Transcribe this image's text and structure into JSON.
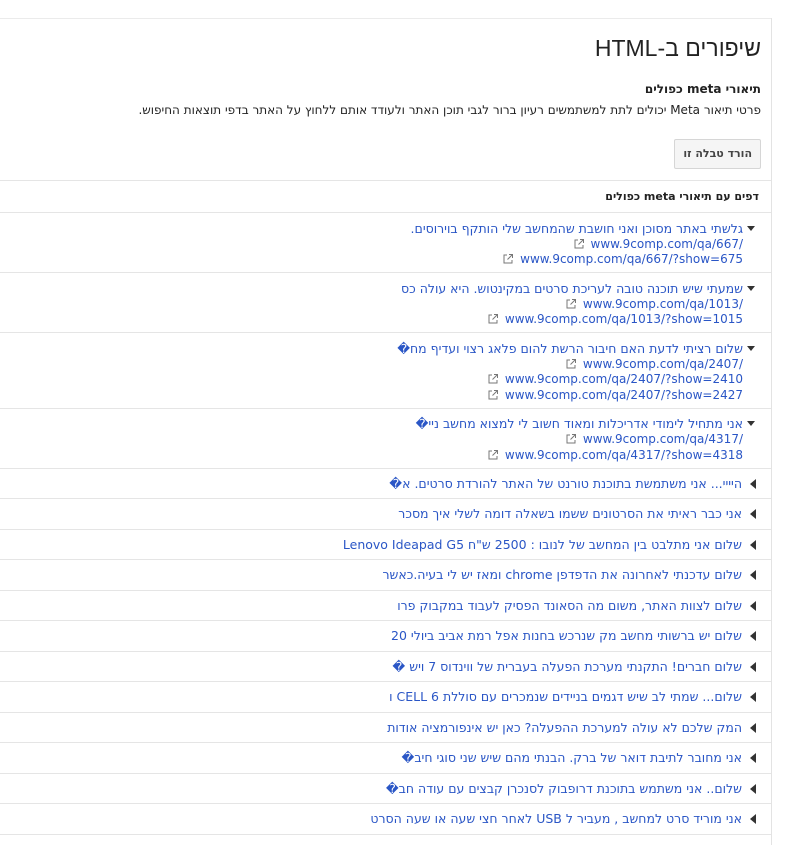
{
  "page_title": "שיפורים ב-HTML",
  "section": {
    "title": "תיאורי meta כפולים",
    "description": "פרטי תיאור Meta יכולים לתת למשתמשים רעיון ברור לגבי תוכן האתר ולעודד אותם ללחוץ על האתר בדפי תוצאות החיפוש."
  },
  "download_button": "הורד טבלה זו",
  "table_header": "דפים עם תיאורי meta כפולים",
  "expanded_rows": [
    {
      "title": "גלשתי באתר מסוכן ואני חושבת שהמחשב שלי הותקף בוירוסים.",
      "urls": [
        "www.9comp.com/qa/667/",
        "www.9comp.com/qa/667/?show=675"
      ]
    },
    {
      "title": "שמעתי שיש תוכנה טובה לעריכת סרטים במקינטוש. היא עולה כס",
      "urls": [
        "www.9comp.com/qa/1013/",
        "www.9comp.com/qa/1013/?show=1015"
      ]
    },
    {
      "title": "שלום רציתי לדעת האם חיבור הרשת להום פלאג רצוי ועדיף מח�",
      "urls": [
        "www.9comp.com/qa/2407/",
        "www.9comp.com/qa/2407/?show=2410",
        "www.9comp.com/qa/2407/?show=2427"
      ]
    },
    {
      "title": "אני מתחיל לימודי אדריכלות ומאוד חשוב לי למצוא מחשב ניי�",
      "urls": [
        "www.9comp.com/qa/4317/",
        "www.9comp.com/qa/4317/?show=4318"
      ]
    }
  ],
  "collapsed_rows": [
    "היייי... אני משתמשת בתוכנת טורנט של האתר להורדת סרטים. א�",
    "אני כבר ראיתי את הסרטונים ששמו בשאלה דומה לשלי איך מסכר",
    "שלום אני מתלבט בין המחשב של לנובו : 2500 ש\"ח Lenovo Ideapad G5",
    "שלום עדכנתי לאחרונה את הדפדפן chrome ומאז יש לי בעיה.כאשר",
    "שלום לצוות האתר, משום מה הסאונד הפסיק לעבוד במקבוק פרו",
    "שלום יש ברשותי מחשב מק שנרכש בחנות אפל רמת אביב ביולי 20",
    "שלום חברים! התקנתי מערכת הפעלה בעברית של ווינדוס 7 ויש �",
    "שלום... שמתי לב שיש דגמים בניידים שנמכרים עם סוללת 6 CELL ו",
    "המק שלכם לא עולה למערכת ההפעלה? כאן יש אינפורמציה אודות",
    "אני מחובר לתיבת דואר של ברק. הבנתי מהם שיש שני סוגי חיב�",
    "שלום.. אני משתמש בתוכנת דרופבוק לסנכרן קבצים עם עודה חב�",
    "אני מוריד סרט למחשב , מעביר ל USB לאחר חצי שעה או שעה הסרט"
  ],
  "colors": {
    "link": "#2a56c6",
    "text": "#222222",
    "border": "#e5e5e5"
  },
  "icons": {
    "expanded": "caret-down-icon",
    "collapsed": "caret-left-icon",
    "url": "external-link-icon"
  }
}
